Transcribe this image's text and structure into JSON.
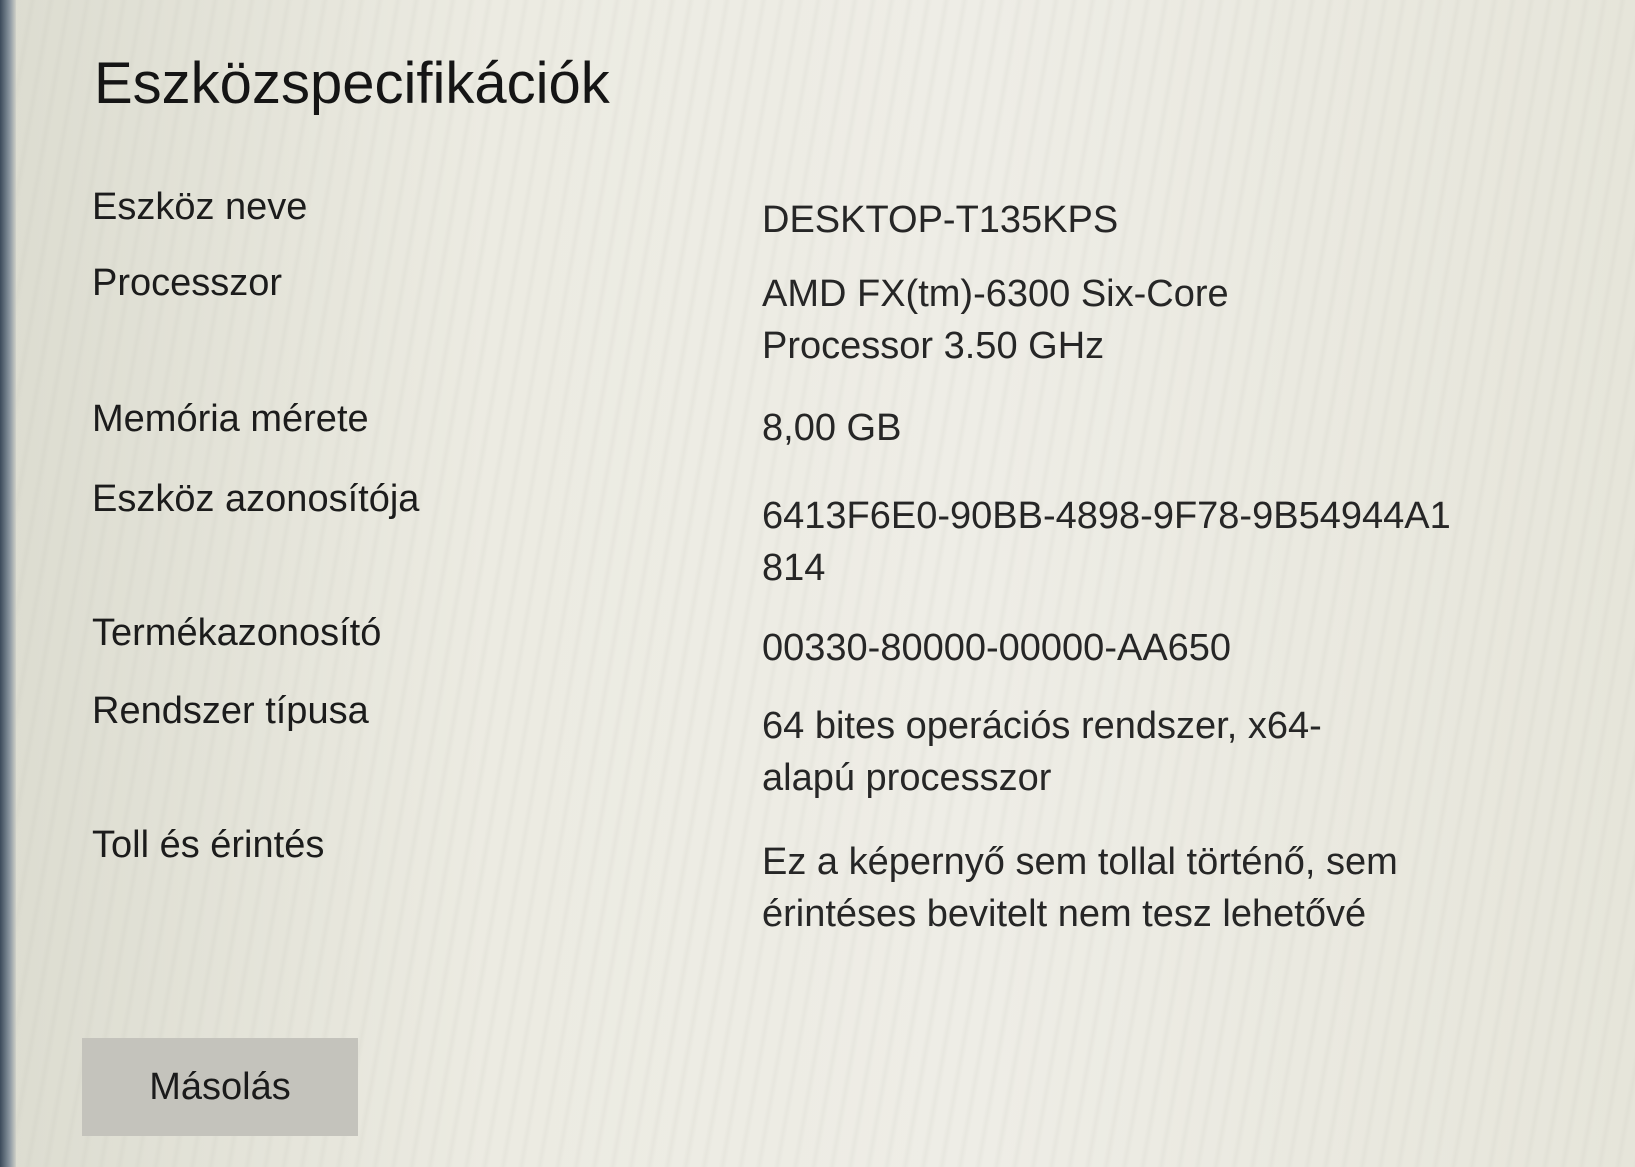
{
  "title": "Eszközspecifikációk",
  "specs": [
    {
      "label": "Eszköz neve",
      "value": "DESKTOP-T135KPS"
    },
    {
      "label": "Processzor",
      "value": "AMD FX(tm)-6300 Six-Core Processor 3.50 GHz"
    },
    {
      "label": "Memória mérete",
      "value": "8,00 GB"
    },
    {
      "label": "Eszköz azonosítója",
      "value": "6413F6E0-90BB-4898-9F78-9B54944A1814"
    },
    {
      "label": "Termékazonosító",
      "value": "00330-80000-00000-AA650"
    },
    {
      "label": "Rendszer típusa",
      "value": "64 bites operációs rendszer, x64-alapú processzor"
    },
    {
      "label": "Toll és érintés",
      "value": "Ez a képernyő sem tollal történő, sem érintéses bevitelt nem tesz lehetővé"
    }
  ],
  "copy_button_label": "Másolás",
  "colors": {
    "background": "#e9e8de",
    "text": "#202020",
    "button": "#c4c3bc"
  }
}
